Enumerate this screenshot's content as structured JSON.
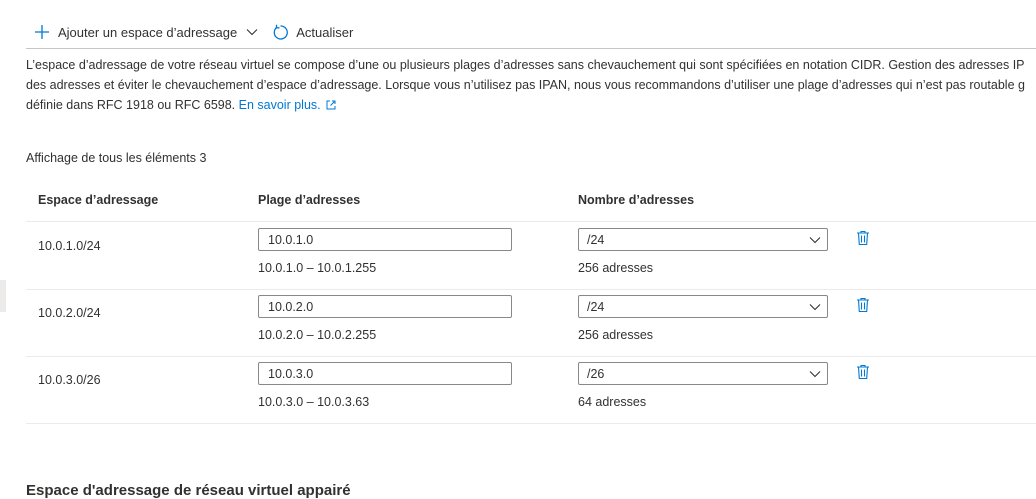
{
  "toolbar": {
    "add_label": "Ajouter un espace d’adressage",
    "add_icon": "plus-icon",
    "dropdown_icon": "chevron-down-icon",
    "refresh_label": "Actualiser",
    "refresh_icon": "refresh-icon"
  },
  "description": {
    "line1": "L’espace d’adressage de votre réseau virtuel se compose d’une ou plusieurs plages d’adresses sans chevauchement qui sont spécifiées en notation CIDR. Gestion des adresses IP",
    "line2": "des adresses et éviter le chevauchement d’espace d’adressage. Lorsque vous n’utilisez pas IPAN, nous vous recommandons d’utiliser une plage d’adresses qui n’est pas routable g",
    "line3": "définie dans RFC 1918 ou RFC 6598.",
    "link": "En savoir plus.",
    "link_icon": "external-link-icon"
  },
  "item_count": "Affichage de tous les éléments 3",
  "table": {
    "headers": [
      "Espace d’adressage",
      "Plage d’adresses",
      "Nombre d’adresses"
    ],
    "rows": [
      {
        "space": "10.0.1.0/24",
        "input": "10.0.1.0",
        "range": "10.0.1.0 – 10.0.1.255",
        "prefix": "/24",
        "count": "256 adresses"
      },
      {
        "space": "10.0.2.0/24",
        "input": "10.0.2.0",
        "range": "10.0.2.0 – 10.0.2.255",
        "prefix": "/24",
        "count": "256 adresses"
      },
      {
        "space": "10.0.3.0/26",
        "input": "10.0.3.0",
        "range": "10.0.3.0 – 10.0.3.63",
        "prefix": "/26",
        "count": "64 adresses"
      }
    ],
    "delete_icon": "trash-icon"
  },
  "section_title": "Espace d'adressage de réseau virtuel appairé",
  "colors": {
    "accent": "#0078d4",
    "text": "#323130",
    "border": "#8a8886",
    "divider": "#edebe9"
  }
}
